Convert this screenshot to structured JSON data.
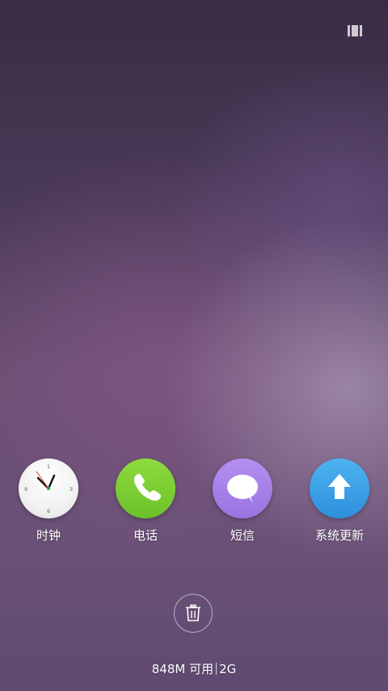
{
  "recents": {
    "view_toggle_icon": "recents-view-icon"
  },
  "apps": [
    {
      "label": "时钟",
      "icon": "clock-icon",
      "color": "#f1f1f1"
    },
    {
      "label": "电话",
      "icon": "phone-icon",
      "color": "#7ccf33"
    },
    {
      "label": "短信",
      "icon": "message-icon",
      "color": "#a884ea"
    },
    {
      "label": "系统更新",
      "icon": "upload-arrow-icon",
      "color": "#3aa0e6"
    }
  ],
  "clear_all": {
    "icon": "trash-icon"
  },
  "memory": {
    "available": "848M 可用",
    "total": "2G"
  }
}
